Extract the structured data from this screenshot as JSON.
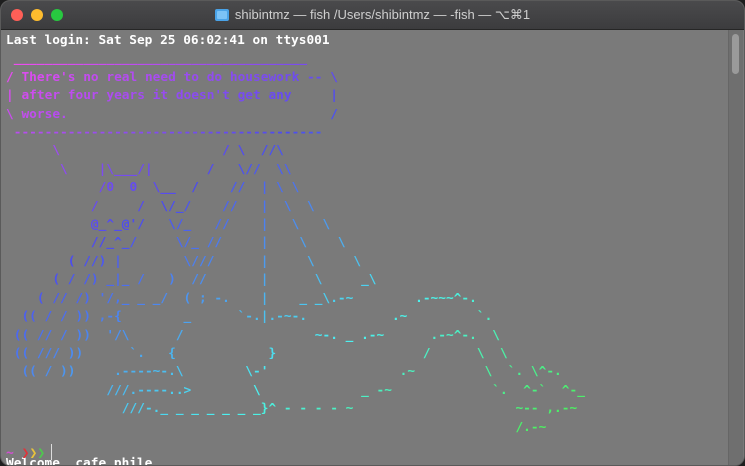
{
  "window": {
    "title": "shibintmz — fish /Users/shibintmz — -fish — ⌥⌘1",
    "accent": "#4aa3e8"
  },
  "terminal": {
    "last_login": "Last login: Sat Sep 25 06:02:41 on ttys001",
    "art_lines": [
      " ______________________________________",
      "/ There's no real need to do housework -- \\",
      "| after four years it doesn't get any     |",
      "\\ worse.                                  /",
      " ----------------------------------------",
      "      \\                     / \\  //\\",
      "       \\    |\\___/|       /   \\//  \\\\",
      "            /0  0  \\__  /    //  | \\ \\",
      "           /     /  \\/_/    //   |  \\  \\",
      "           @_^_@'/   \\/_   //    |   \\   \\",
      "           //_^_/     \\/_ //     |    \\    \\",
      "        ( //) |        \\///      |     \\     \\",
      "      ( / /) _|_ /   )  //       |      \\     _\\",
      "    ( // /) '/,_ _ _/  ( ; -.    |    _ _\\.-~        .-~~~^-.",
      "  (( / / )) ,-{        _      `-.|.-~-.           .~         `.",
      " (( // / ))  '/\\      /                 ~-. _ .-~      .-~^-.  \\",
      " (( /// ))      `.   {            }                   /      \\  \\",
      "  (( / ))     .----~-.\\        \\-'                 .~         \\  `. \\^-.",
      "             ///.----..>        \\             _ -~             `.  ^-`  ^-_",
      "               ///-._ _ _ _ _ _ _}^ - - - - ~                     ~-- ,.-~",
      "                                                                  /.-~"
    ],
    "welcome": "Welcome _cafe_phile_",
    "prompt_tilde": "~",
    "prompt_arrows": "❯❯❯"
  },
  "colors": {
    "text": "#ffffff",
    "prompt_tilde": "#d14fd1",
    "arrow_1": "#e0343a",
    "arrow_2": "#e8c33c",
    "arrow_3": "#4ec94e"
  }
}
